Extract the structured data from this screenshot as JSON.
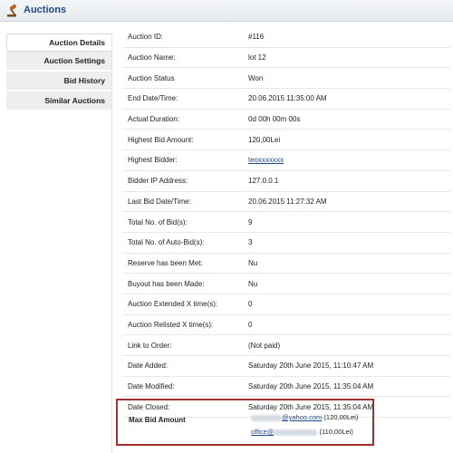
{
  "header": {
    "title": "Auctions",
    "icon": "gavel-icon"
  },
  "sidebar": {
    "items": [
      {
        "label": "Auction Details",
        "active": true
      },
      {
        "label": "Auction Settings"
      },
      {
        "label": "Bid History"
      },
      {
        "label": "Similar Auctions"
      }
    ]
  },
  "details": {
    "rows": [
      {
        "label": "Auction ID:",
        "value": "#116"
      },
      {
        "label": "Auction Name:",
        "value": "lot 12"
      },
      {
        "label": "Auction Status",
        "value": "Won"
      },
      {
        "label": "End Date/Time:",
        "value": "20.06.2015 11:35:00 AM"
      },
      {
        "label": "Actual Duration:",
        "value": "0d 00h 00m 00s"
      },
      {
        "label": "Highest Bid Amount:",
        "value": "120,00Lei"
      },
      {
        "label": "Highest Bidder:",
        "value": "teoxxxxxxx"
      },
      {
        "label": "Bidder IP Address:",
        "value": "127.0.0.1"
      },
      {
        "label": "Last Bid Date/Time:",
        "value": "20.06.2015 11:27:32 AM"
      },
      {
        "label": "Total No. of Bid(s):",
        "value": "9"
      },
      {
        "label": "Total No. of Auto-Bid(s):",
        "value": "3"
      },
      {
        "label": "Reserve has been Met:",
        "value": "Nu"
      },
      {
        "label": "Buyout has been Made:",
        "value": "Nu"
      },
      {
        "label": "Auction Extended X time(s):",
        "value": "0"
      },
      {
        "label": "Auction Relisted X time(s):",
        "value": "0"
      },
      {
        "label": "Link to Order:",
        "value": "(Not paid)"
      },
      {
        "label": "Date Added:",
        "value": "Saturday 20th June 2015, 11:10:47 AM"
      },
      {
        "label": "Date Modified:",
        "value": "Saturday 20th June 2015, 11:35:04 AM"
      },
      {
        "label": "Date Closed:",
        "value": "Saturday 20th June 2015, 11:35:04 AM"
      }
    ]
  },
  "max_bid": {
    "label": "Max Bid Amount",
    "entries": [
      {
        "email_suffix": "@yahoo.com",
        "amount": "(120,00Lei)"
      },
      {
        "email_prefix": "office@",
        "amount": "(110,00Lei)"
      }
    ]
  },
  "colors": {
    "accent": "#1d4a8a",
    "highlight_border": "#a23030"
  }
}
